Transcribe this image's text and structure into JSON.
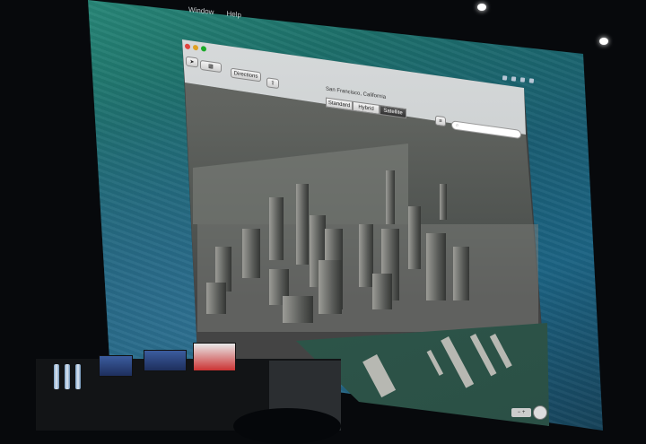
{
  "menubar": {
    "items": [
      "Window",
      "Help"
    ]
  },
  "window": {
    "title": "San Francisco, California",
    "toolbar": {
      "directions_label": "Directions",
      "view_modes": [
        "Standard",
        "Hybrid",
        "Satellite"
      ],
      "selected_view": "Satellite",
      "search_placeholder": ""
    }
  },
  "icons": [
    "location-arrow-icon",
    "3d-toggle-icon",
    "share-icon",
    "compass-icon",
    "search-icon"
  ],
  "colors": {
    "desktop": "#1d6f6a",
    "window_chrome": "#c9cccd",
    "bay_water": "#2f5a4c"
  }
}
